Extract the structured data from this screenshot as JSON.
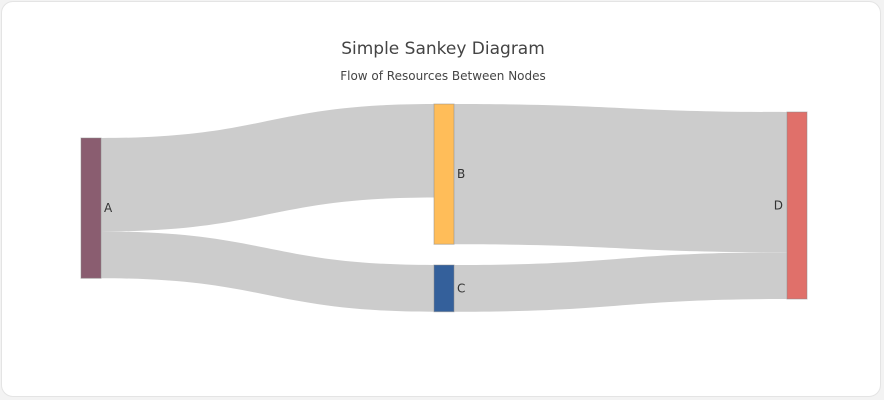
{
  "chart_data": {
    "type": "sankey",
    "title": "Simple Sankey Diagram",
    "subtitle": "Flow of Resources Between Nodes",
    "nodes": [
      {
        "label": "A",
        "color": "#8a5d70"
      },
      {
        "label": "B",
        "color": "#ffbd59"
      },
      {
        "label": "C",
        "color": "#34609b"
      },
      {
        "label": "D",
        "color": "#e0706a"
      }
    ],
    "links": [
      {
        "source": "A",
        "target": "B",
        "value": 10
      },
      {
        "source": "A",
        "target": "C",
        "value": 5
      },
      {
        "source": "B",
        "target": "D",
        "value": 15
      },
      {
        "source": "C",
        "target": "D",
        "value": 5
      }
    ],
    "link_color": "#cccccc"
  }
}
